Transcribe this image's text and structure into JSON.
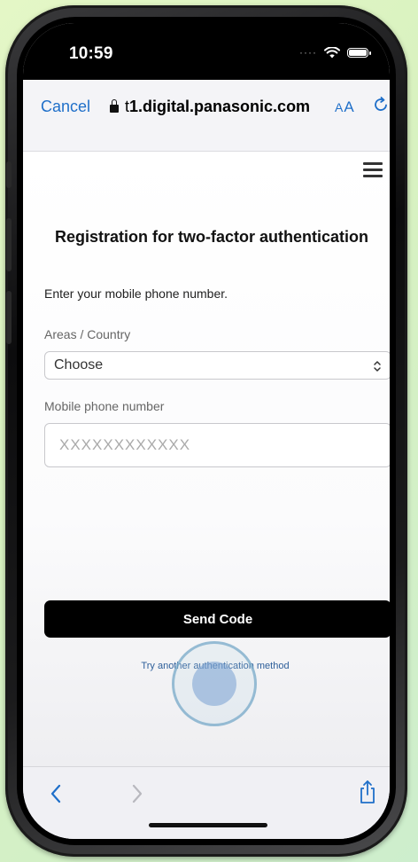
{
  "status_bar": {
    "time": "10:59",
    "signal_icon": "signal-dots-icon",
    "wifi_icon": "wifi-icon",
    "battery_icon": "battery-icon"
  },
  "browser": {
    "cancel_label": "Cancel",
    "url_prefix": "t",
    "url_host": "1.digital.panasonic.com",
    "text_size_label_small": "A",
    "text_size_label_large": "A",
    "lock_icon": "lock-icon",
    "reload_icon": "reload-icon",
    "accent_color": "#1f6fc9"
  },
  "page": {
    "menu_icon": "hamburger-menu-icon",
    "title": "Registration for two-factor authentication",
    "instruction": "Enter your mobile phone number.",
    "area_label": "Areas / Country",
    "area_select": {
      "selected": "Choose",
      "icon": "chevron-up-down-icon"
    },
    "phone_label": "Mobile phone number",
    "phone_placeholder": "XXXXXXXXXXXX",
    "send_button": "Send Code",
    "alt_method_link": "Try another authentication method"
  },
  "toolbar": {
    "back_icon": "back-chevron-icon",
    "forward_icon": "forward-chevron-icon",
    "share_icon": "share-icon"
  }
}
